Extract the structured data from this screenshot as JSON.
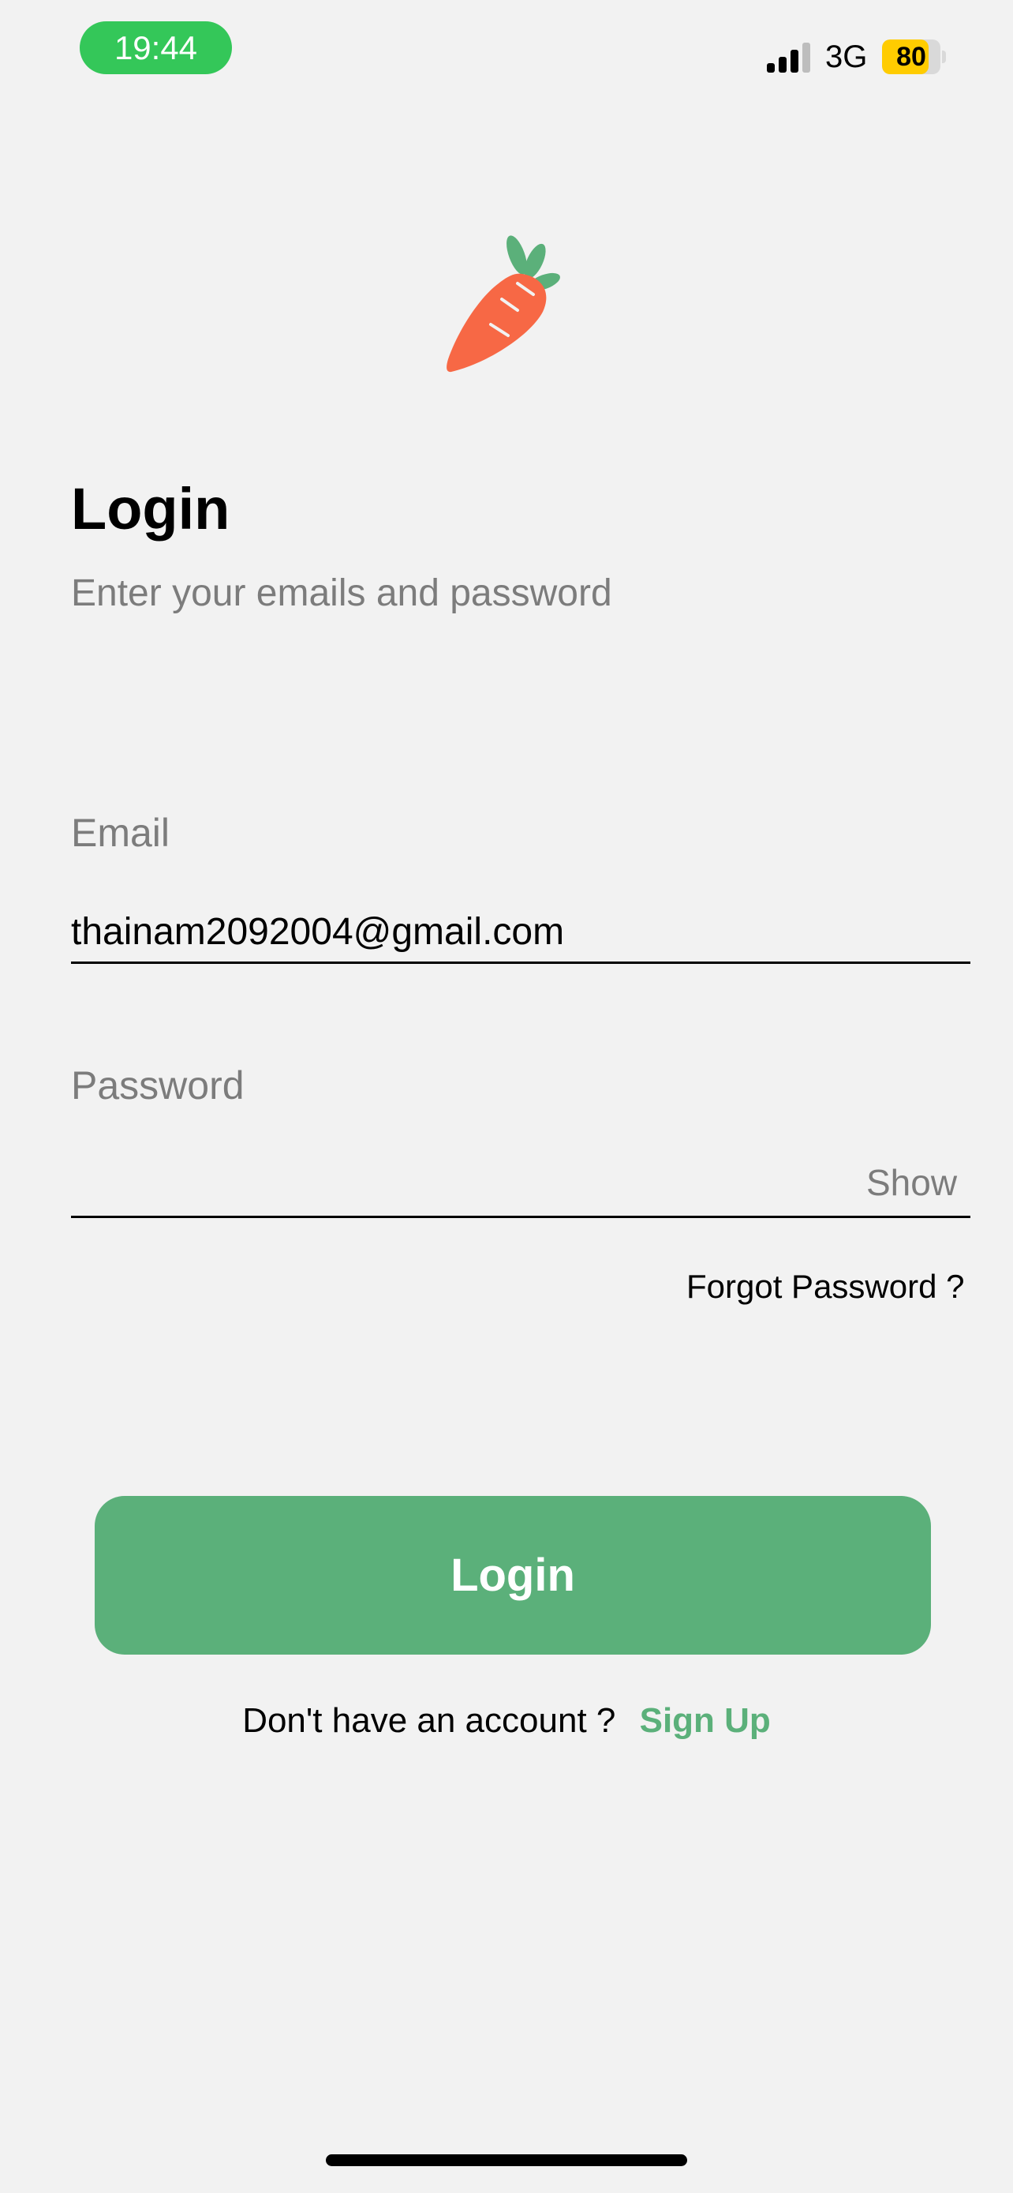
{
  "status_bar": {
    "time": "19:44",
    "time_pill_color": "#34C759",
    "network": "3G",
    "battery_level": "80",
    "battery_fraction": 0.8,
    "battery_color": "#FFCC00",
    "signal_icon": "cellular-signal-icon"
  },
  "logo": {
    "icon": "carrot-icon",
    "body_color": "#F76845",
    "leaf_color": "#5BB07A"
  },
  "header": {
    "title": "Login",
    "subtitle": "Enter your emails and password"
  },
  "form": {
    "email_label": "Email",
    "email_value": "thainam2092004@gmail.com",
    "password_label": "Password",
    "password_value": "",
    "show_label": "Show",
    "forgot_label": "Forgot Password ?"
  },
  "actions": {
    "login_label": "Login",
    "accent_color": "#5BB07A",
    "signup_prompt": "Don't have an account ?",
    "signup_label": "Sign Up"
  }
}
